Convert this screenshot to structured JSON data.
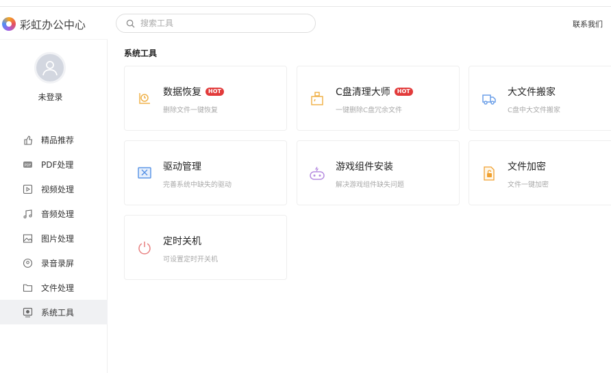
{
  "app": {
    "title": "彩虹办公中心",
    "contact": "联系我们"
  },
  "search": {
    "placeholder": "搜索工具"
  },
  "user": {
    "status": "未登录"
  },
  "sidebar": {
    "items": [
      {
        "label": "精品推荐",
        "icon": "thumbs-up-icon"
      },
      {
        "label": "PDF处理",
        "icon": "pdf-icon"
      },
      {
        "label": "视频处理",
        "icon": "video-icon"
      },
      {
        "label": "音频处理",
        "icon": "music-icon"
      },
      {
        "label": "图片处理",
        "icon": "image-icon"
      },
      {
        "label": "录音录屏",
        "icon": "record-icon"
      },
      {
        "label": "文件处理",
        "icon": "folder-icon"
      },
      {
        "label": "系统工具",
        "icon": "monitor-icon",
        "active": true
      }
    ]
  },
  "main": {
    "section_title": "系统工具",
    "hot_label": "HOT",
    "cards": [
      {
        "title": "数据恢复",
        "desc": "删除文件一键恢复",
        "hot": true,
        "icon": "recovery-icon",
        "color": "#f0b24a"
      },
      {
        "title": "C盘清理大师",
        "desc": "一键删除C盘冗余文件",
        "hot": true,
        "icon": "broom-icon",
        "color": "#f0b24a"
      },
      {
        "title": "大文件搬家",
        "desc": "C盘中大文件搬家",
        "hot": false,
        "icon": "truck-icon",
        "color": "#6a9ee8"
      },
      {
        "title": "驱动管理",
        "desc": "完善系统中缺失的驱动",
        "hot": false,
        "icon": "driver-icon",
        "color": "#5b95e6"
      },
      {
        "title": "游戏组件安装",
        "desc": "解决游戏组件缺失问题",
        "hot": false,
        "icon": "gamepad-icon",
        "color": "#b58be0"
      },
      {
        "title": "文件加密",
        "desc": "文件一键加密",
        "hot": false,
        "icon": "lock-file-icon",
        "color": "#f0a030"
      },
      {
        "title": "定时关机",
        "desc": "可设置定时开关机",
        "hot": false,
        "icon": "power-icon",
        "color": "#e88080"
      }
    ]
  }
}
